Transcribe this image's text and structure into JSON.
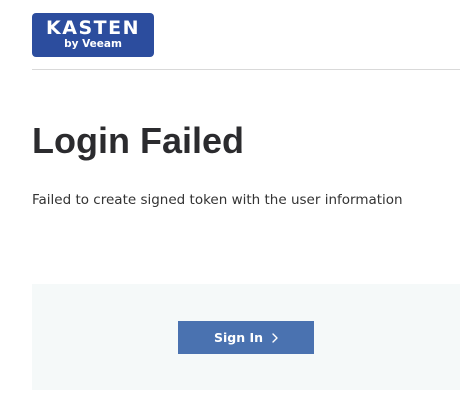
{
  "header": {
    "logo": {
      "main_text": "KASTEN",
      "sub_text": "by Veeam"
    }
  },
  "main": {
    "title": "Login Failed",
    "message": "Failed to create signed token with the user information"
  },
  "actions": {
    "sign_in_label": "Sign In",
    "sign_in_icon": "chevron-right-icon"
  },
  "colors": {
    "brand": "#2c4d9e",
    "button": "#4a72b0",
    "panel_background": "#f5f9f9",
    "title_text": "#2b2b2e"
  }
}
